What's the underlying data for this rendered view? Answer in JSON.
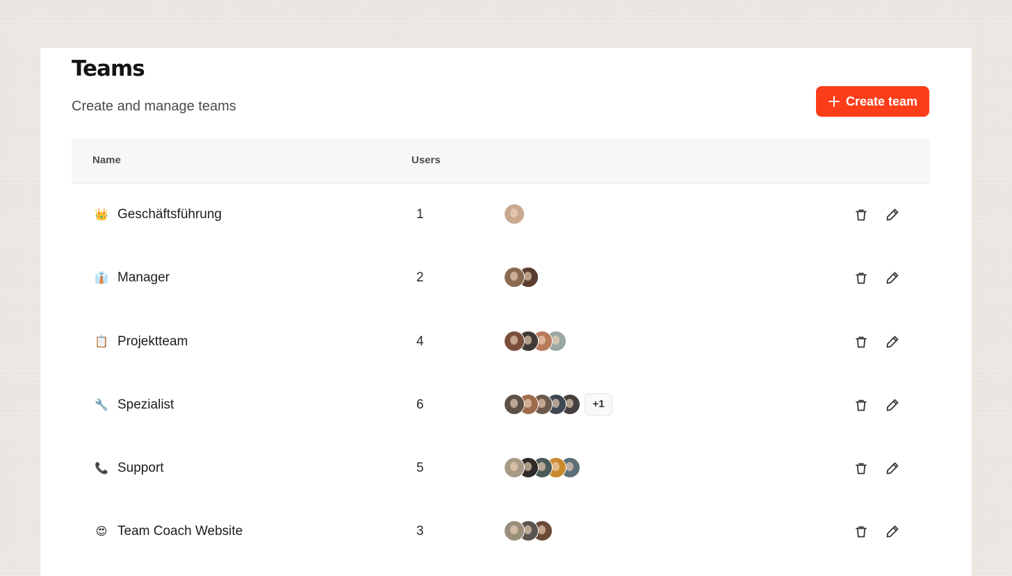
{
  "page": {
    "title": "Teams",
    "subtitle": "Create and manage teams",
    "create_button_label": "Create team"
  },
  "table": {
    "columns": {
      "name": "Name",
      "users": "Users"
    },
    "rows": [
      {
        "emoji": "👑",
        "name": "Geschäftsführung",
        "user_count": "1",
        "avatar_colors": [
          "#c9a98f"
        ],
        "more": ""
      },
      {
        "emoji": "👔",
        "name": "Manager",
        "user_count": "2",
        "avatar_colors": [
          "#8a6b52",
          "#5a3d2e"
        ],
        "more": ""
      },
      {
        "emoji": "📋",
        "name": "Projektteam",
        "user_count": "4",
        "avatar_colors": [
          "#7b4e3c",
          "#3f3a36",
          "#b87a5a",
          "#9aa7a3"
        ],
        "more": ""
      },
      {
        "emoji": "🔧",
        "name": "Spezialist",
        "user_count": "6",
        "avatar_colors": [
          "#5c5049",
          "#a06a4c",
          "#6e5a4c",
          "#3e4752",
          "#454040"
        ],
        "more": "+1"
      },
      {
        "emoji": "📞",
        "name": "Support",
        "user_count": "5",
        "avatar_colors": [
          "#a89a85",
          "#2f2b2a",
          "#4a5a58",
          "#c98a2f",
          "#5c6f78"
        ],
        "more": ""
      },
      {
        "emoji": "😍",
        "name": "Team Coach Website",
        "user_count": "3",
        "avatar_colors": [
          "#9a8f7a",
          "#5a5450",
          "#6b4a38"
        ],
        "more": ""
      }
    ]
  },
  "colors": {
    "accent": "#fc3d1a",
    "background": "#ece7e2",
    "card": "#ffffff",
    "header_bg": "#f7f7f7"
  },
  "icons": {
    "create": "plus-icon",
    "delete": "trash-icon",
    "edit": "pencil-icon"
  }
}
